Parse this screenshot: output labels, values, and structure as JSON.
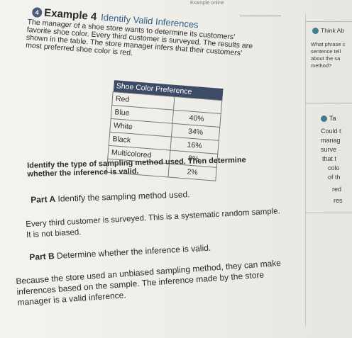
{
  "top_note": "Example online",
  "example": {
    "label": "Example 4",
    "title": "Identify Valid Inferences",
    "badge": "4"
  },
  "intro_lines": [
    "The manager of a shoe store wants to determine its customers'",
    "favorite shoe color. Every third customer is surveyed. The results are",
    "shown in the table. The store manager infers that their customers'",
    "most preferred shoe color is red."
  ],
  "table": {
    "caption": "Shoe Color Preference",
    "rows": [
      {
        "color": "Red",
        "value": ""
      },
      {
        "color": "Blue",
        "value": "40%"
      },
      {
        "color": "White",
        "value": "34%"
      },
      {
        "color": "Black",
        "value": "16%"
      },
      {
        "color": "Multicolored",
        "value": "8%"
      },
      {
        "color": "",
        "value": "2%"
      }
    ]
  },
  "sidebar": {
    "think_title": "Think Ab",
    "think_lines": [
      "What phrase c",
      "sentence tell",
      "about the sa",
      "method?"
    ],
    "take_title": "Ta",
    "take_lines": [
      "Could t",
      "manag",
      "surve",
      "that t",
      "colo",
      "of th",
      "red",
      "res"
    ]
  },
  "task_lines": [
    "Identify the type of sampling method used. Then determine",
    "whether the inference is valid."
  ],
  "part_a": {
    "label": "Part A",
    "prompt": "Identify the sampling method used.",
    "answer_lines": [
      "Every third customer is surveyed. This is a systematic random sample.",
      "It is not biased."
    ]
  },
  "part_b": {
    "label": "Part B",
    "prompt": "Determine whether the inference is valid.",
    "answer_lines": [
      "Because the store used an unbiased sampling method, they can make",
      "inferences based on the sample. The inference made by the store",
      "manager is a valid inference."
    ]
  },
  "colors": {
    "accent_blue": "#2e5f8a",
    "table_header": "#3e4b66",
    "teal_dot": "#3e7d8d"
  }
}
